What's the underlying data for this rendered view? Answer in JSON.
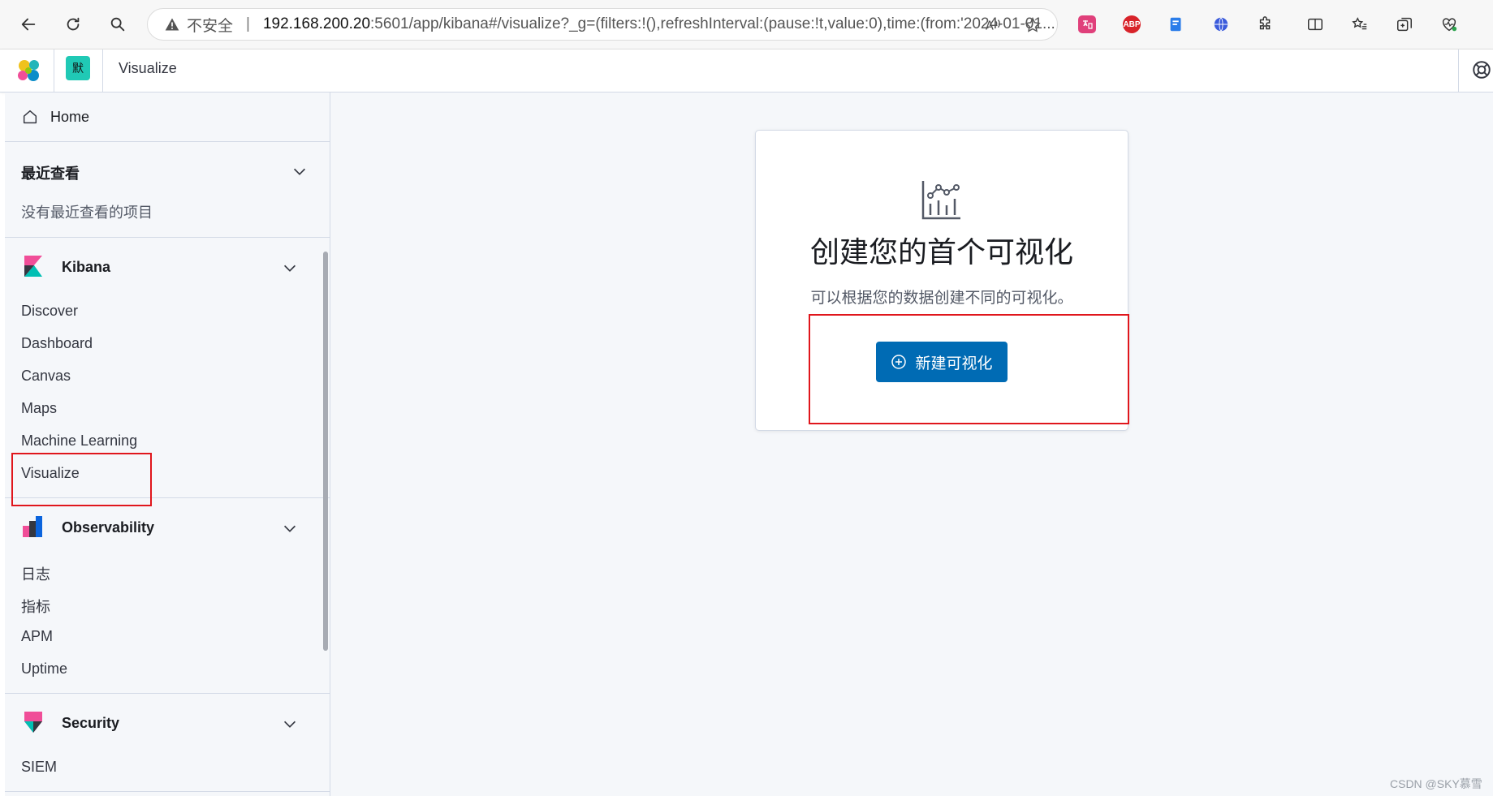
{
  "browser": {
    "security_label": "不安全",
    "url_host": "192.168.200.20",
    "url_path": ":5601/app/kibana#/visualize?_g=(filters:!(),refreshInterval:(pause:!t,value:0),time:(from:'2024-01-01..."
  },
  "extensions": {
    "abp_label": "ABP"
  },
  "header": {
    "space_initial": "默",
    "breadcrumb": "Visualize"
  },
  "sidebar": {
    "home_label": "Home",
    "recent": {
      "title": "最近查看",
      "empty_text": "没有最近查看的项目"
    },
    "groups": [
      {
        "title": "Kibana",
        "links": [
          "Discover",
          "Dashboard",
          "Canvas",
          "Maps",
          "Machine Learning",
          "Visualize"
        ]
      },
      {
        "title": "Observability",
        "links": [
          "日志",
          "指标",
          "APM",
          "Uptime"
        ]
      },
      {
        "title": "Security",
        "links": [
          "SIEM"
        ]
      }
    ]
  },
  "main": {
    "title": "创建您的首个可视化",
    "subtitle": "可以根据您的数据创建不同的可视化。",
    "create_button_label": "新建可视化"
  },
  "colors": {
    "accent_blue": "#006bb4",
    "annotation_red": "#e0161c",
    "space_badge": "#20c9b5"
  },
  "watermark": "CSDN @SKY慕雪"
}
